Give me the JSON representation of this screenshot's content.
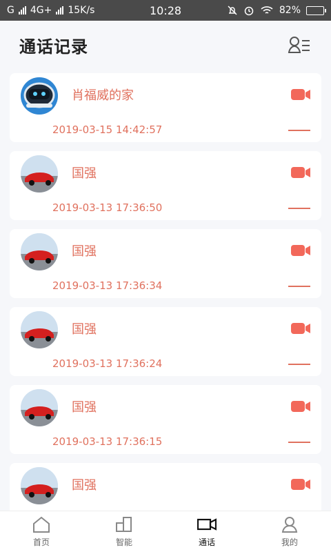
{
  "status_bar": {
    "carrier1": "G",
    "carrier2": "4G+",
    "speed": "15K/s",
    "time": "10:28",
    "battery": "82%"
  },
  "header": {
    "title": "通话记录",
    "contacts_icon": "contacts-list-icon"
  },
  "calls": [
    {
      "name": "肖福威的家",
      "time": "2019-03-15 14:42:57",
      "avatar": "robot-avatar"
    },
    {
      "name": "国强",
      "time": "2019-03-13 17:36:50",
      "avatar": "car-avatar"
    },
    {
      "name": "国强",
      "time": "2019-03-13 17:36:34",
      "avatar": "car-avatar"
    },
    {
      "name": "国强",
      "time": "2019-03-13 17:36:24",
      "avatar": "car-avatar"
    },
    {
      "name": "国强",
      "time": "2019-03-13 17:36:15",
      "avatar": "car-avatar"
    },
    {
      "name": "国强",
      "time": "",
      "avatar": "car-avatar"
    }
  ],
  "tabbar": {
    "home": "首页",
    "smart": "智能",
    "calls": "通话",
    "mine": "我的"
  },
  "colors": {
    "accent": "#e0715e",
    "camera": "#f2685a",
    "status_bg": "#4a4a4a"
  }
}
